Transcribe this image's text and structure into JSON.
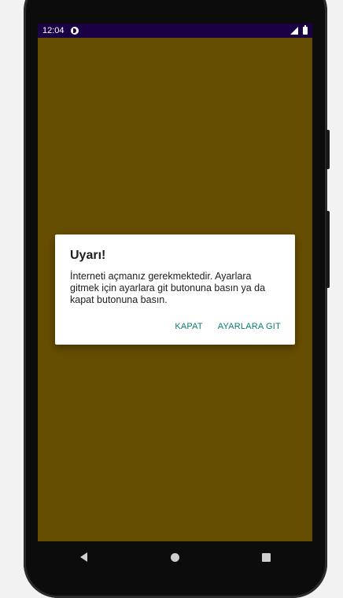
{
  "statusbar": {
    "time": "12:04",
    "icons": [
      "data-saver-icon",
      "signal-icon",
      "battery-icon"
    ],
    "background": "#1a0044"
  },
  "app": {
    "background": "#654d00"
  },
  "dialog": {
    "title": "Uyarı!",
    "message": "İnterneti açmanız gerekmektedir. Ayarlara gitmek için ayarlara git butonuna basın ya da kapat butonuna basın.",
    "buttons": {
      "close": "KAPAT",
      "settings": "AYARLARA GIT"
    },
    "accent": "#0b7a70"
  },
  "navigation": {
    "icons": [
      "back-icon",
      "home-icon",
      "recent-apps-icon"
    ]
  }
}
